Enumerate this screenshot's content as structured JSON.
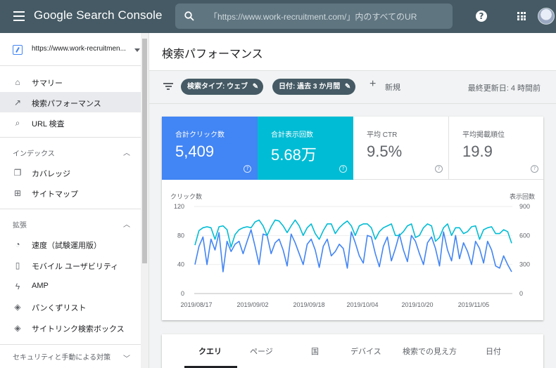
{
  "header": {
    "app_title": "Google Search Console",
    "search_placeholder": "「https://www.work-recruitment.com/」内のすべてのUR"
  },
  "sidebar": {
    "property": "https://www.work-recruitmen...",
    "items_top": [
      {
        "label": "サマリー",
        "icon": "home-icon"
      },
      {
        "label": "検索パフォーマンス",
        "icon": "trending-icon",
        "active": true
      },
      {
        "label": "URL 検査",
        "icon": "search-icon"
      }
    ],
    "section_index": "インデックス",
    "items_index": [
      {
        "label": "カバレッジ",
        "icon": "copy-icon"
      },
      {
        "label": "サイトマップ",
        "icon": "sitemap-icon"
      }
    ],
    "section_ext": "拡張",
    "items_ext": [
      {
        "label": "速度（試験運用版）",
        "icon": "speed-icon"
      },
      {
        "label": "モバイル ユーザビリティ",
        "icon": "mobile-icon"
      },
      {
        "label": "AMP",
        "icon": "bolt-icon"
      },
      {
        "label": "パンくずリスト",
        "icon": "layers-icon"
      },
      {
        "label": "サイトリンク検索ボックス",
        "icon": "layers-icon"
      }
    ],
    "section_security": "セキュリティと手動による対策"
  },
  "main": {
    "title": "検索パフォーマンス",
    "filters": {
      "search_type": "検索タイプ: ウェブ",
      "date": "日付: 過去 3 か月間",
      "new": "新規",
      "last_updated": "最終更新日: 4 時間前"
    },
    "metrics": [
      {
        "label": "合計クリック数",
        "value": "5,409"
      },
      {
        "label": "合計表示回数",
        "value": "5.68万"
      },
      {
        "label": "平均 CTR",
        "value": "9.5%"
      },
      {
        "label": "平均掲載順位",
        "value": "19.9"
      }
    ],
    "tabs": [
      "クエリ",
      "ページ",
      "国",
      "デバイス",
      "検索での見え方",
      "日付"
    ]
  },
  "chart_data": {
    "type": "line",
    "ylabel_left": "クリック数",
    "ylabel_right": "表示回数",
    "yticks_left": [
      "120",
      "80",
      "40",
      "0"
    ],
    "yticks_right": [
      "900",
      "600",
      "300",
      "0"
    ],
    "ylim_left": [
      0,
      120
    ],
    "ylim_right": [
      0,
      900
    ],
    "xticks": [
      "2019/08/17",
      "2019/09/02",
      "2019/09/18",
      "2019/10/04",
      "2019/10/20",
      "2019/11/05"
    ],
    "series": [
      {
        "name": "クリック数",
        "color": "#4285f4",
        "axis": "left",
        "values": [
          40,
          65,
          78,
          40,
          75,
          60,
          84,
          30,
          72,
          58,
          68,
          72,
          55,
          72,
          88,
          65,
          40,
          82,
          80,
          55,
          70,
          75,
          60,
          38,
          82,
          70,
          55,
          40,
          68,
          75,
          60,
          36,
          65,
          75,
          52,
          58,
          68,
          62,
          35,
          85,
          70,
          52,
          42,
          80,
          78,
          55,
          37,
          65,
          78,
          45,
          62,
          82,
          60,
          44,
          80,
          72,
          55,
          40,
          70,
          78,
          62,
          38,
          85,
          60,
          45,
          80,
          48,
          70,
          58,
          40,
          72,
          62,
          42,
          72,
          60,
          38,
          35,
          52,
          40,
          30
        ]
      },
      {
        "name": "表示回数",
        "color": "#00bcd4",
        "axis": "right",
        "values": [
          500,
          650,
          680,
          690,
          680,
          560,
          690,
          700,
          660,
          480,
          610,
          660,
          680,
          690,
          680,
          740,
          760,
          700,
          600,
          690,
          760,
          750,
          700,
          630,
          700,
          760,
          700,
          600,
          680,
          720,
          620,
          560,
          650,
          720,
          720,
          620,
          680,
          720,
          750,
          700,
          600,
          700,
          720,
          720,
          680,
          560,
          640,
          680,
          700,
          720,
          600,
          600,
          640,
          700,
          720,
          580,
          600,
          680,
          720,
          700,
          540,
          580,
          680,
          720,
          600,
          680,
          680,
          620,
          640,
          690,
          700,
          560,
          660,
          680,
          690,
          620,
          620,
          660,
          640,
          520
        ]
      }
    ]
  }
}
